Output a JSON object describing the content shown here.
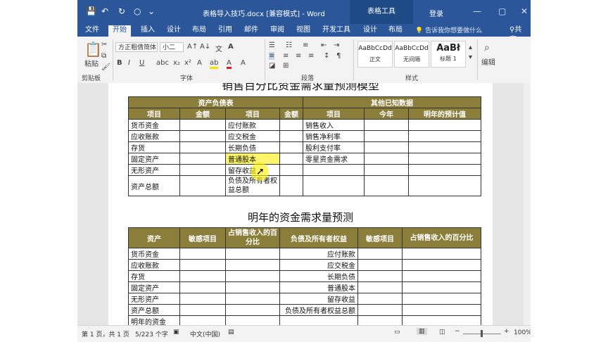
{
  "window": {
    "doc_title": "表格导入技巧.docx [兼容模式] - Word",
    "context_tab": "表格工具",
    "login": "登录",
    "minimize_glyph": "—",
    "restore_glyph": "▢",
    "close_glyph": "✕"
  },
  "tabs": [
    "文件",
    "开始",
    "插入",
    "设计",
    "布局",
    "引用",
    "邮件",
    "审阅",
    "视图",
    "开发工具",
    "设计",
    "布局"
  ],
  "tell_me": "告诉我你想要做什么",
  "share": "共享",
  "ribbon": {
    "paste": "粘贴",
    "clipboard_label": "剪贴板",
    "font_name": "方正粗倩简体",
    "font_size": "小二",
    "font_label": "字体",
    "paragraph_label": "段落",
    "styles_label": "样式",
    "edit_label": "编辑",
    "styles": [
      {
        "sample": "AaBbCcDd",
        "name": "正文"
      },
      {
        "sample": "AaBbCcDd",
        "name": "无间隔"
      },
      {
        "sample": "AaBł",
        "name": "标题 1"
      }
    ]
  },
  "document": {
    "title1": "销售百分比资金需求量预测模型",
    "table1": {
      "group_left": "资产负债表",
      "group_right": "其他已知数据",
      "headers": [
        "项目",
        "金额",
        "项目",
        "金额",
        "项目",
        "今年",
        "明年的预计值"
      ],
      "rows": [
        [
          "货币资金",
          "应付账款",
          "销售收入"
        ],
        [
          "应收账款",
          "应交税金",
          "销售净利率"
        ],
        [
          "存货",
          "长期负债",
          "股利支付率"
        ],
        [
          "固定资产",
          "普通股本",
          "零星资金需求"
        ],
        [
          "无形资产",
          "留存收益",
          ""
        ],
        [
          "资产总额",
          "负债及所有者权益总额",
          ""
        ]
      ]
    },
    "title2": "明年的资金需求量预测",
    "table2": {
      "headers": [
        "资产",
        "敏感项目",
        "占销售收入的百分比",
        "负债及所有者权益",
        "敏感项目",
        "占销售收入的百分比"
      ],
      "rows": [
        [
          "货币资金",
          "应付账款"
        ],
        [
          "应收账款",
          "应交税金"
        ],
        [
          "存货",
          "长期负债"
        ],
        [
          "固定资产",
          "普通股本"
        ],
        [
          "无形资产",
          "留存收益"
        ],
        [
          "资产总额",
          "负债及所有者权益总额"
        ],
        [
          "明年的资金",
          ""
        ]
      ]
    }
  },
  "status": {
    "page": "第 1 页，共 1 页",
    "words": "5/223 个字",
    "lang": "中文(中国)",
    "zoom": "100%"
  }
}
